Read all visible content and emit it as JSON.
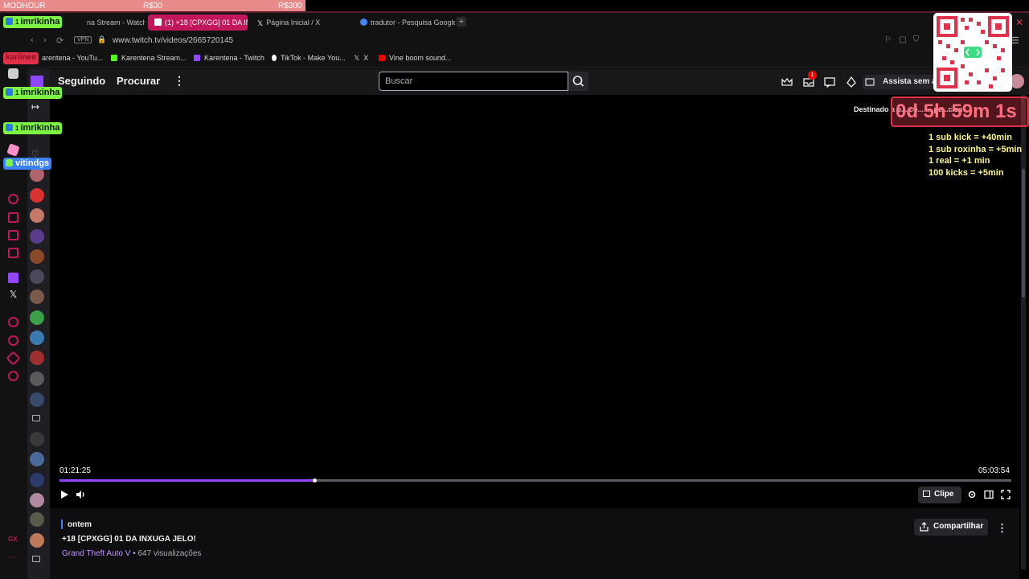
{
  "overlay_bar": {
    "left": "MODHOUR",
    "mid": "R$30",
    "right": "R$300"
  },
  "tabs": [
    {
      "label": "na Stream - Watch",
      "active": false
    },
    {
      "label": "(1) +18 [CPXGG] 01 DA IN...",
      "active": true
    },
    {
      "label": "Página Inicial / X",
      "active": false
    },
    {
      "label": "tradutor - Pesquisa Google",
      "active": false
    }
  ],
  "address": {
    "vpn": "VPN",
    "url": "www.twitch.tv/videos/2665720145"
  },
  "bookmarks": [
    {
      "label": "arentena - YouTu...",
      "color": "#ff0000"
    },
    {
      "label": "Karentena Stream...",
      "color": "#53fc18"
    },
    {
      "label": "Karentena - Twitch",
      "color": "#9147ff"
    },
    {
      "label": "TikTok - Make You...",
      "color": "#ffffff"
    },
    {
      "label": "X",
      "color": "#ffffff"
    },
    {
      "label": "Vine boom sound...",
      "color": "#ff0000"
    }
  ],
  "nav": {
    "following": "Seguindo",
    "browse": "Procurar",
    "search_placeholder": "Buscar",
    "notif_count": "1",
    "watch_no_ads": "Assista sem a"
  },
  "chat": [
    {
      "badge": "1",
      "user": "imrikinha",
      "color": "#7bf542"
    },
    {
      "user": "karlinee",
      "color": "#e0314b"
    },
    {
      "badge": "1",
      "user": "imrikinha",
      "color": "#7bf542"
    },
    {
      "badge": "1",
      "user": "imrikinha",
      "color": "#7bf542"
    },
    {
      "user": "vitindgs",
      "color": "#3b82f6"
    }
  ],
  "overlay": {
    "timer": "0d 5h 59m 1s",
    "destinado": "Destinado a p... co... ... pe...cios",
    "rules": [
      "1 sub kick = +40min",
      "1 sub roxinha = +5min",
      "1 real = +1 min",
      "100 kicks = +5min"
    ]
  },
  "player": {
    "current_time": "01:21:25",
    "duration": "05:03:54",
    "progress": 0.268,
    "clip": "Clipe"
  },
  "info": {
    "date": "ontem",
    "title": "+18 [CPXGG] 01 DA INXUGA JELO!",
    "game": "Grand Theft Auto V",
    "views": " • 647 visualizações",
    "share": "Compartilhar"
  },
  "colors": {
    "accent": "#9147ff",
    "timer_red": "#e0314b",
    "rule_yellow": "#fff98a"
  }
}
